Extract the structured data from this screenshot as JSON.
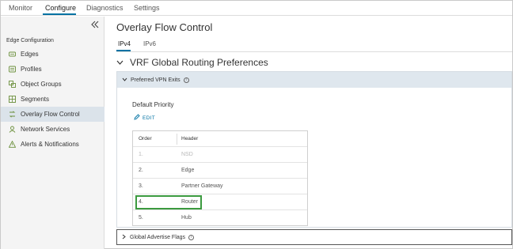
{
  "top_nav": {
    "tabs": [
      {
        "label": "Monitor",
        "active": false
      },
      {
        "label": "Configure",
        "active": true
      },
      {
        "label": "Diagnostics",
        "active": false
      },
      {
        "label": "Settings",
        "active": false
      }
    ]
  },
  "sidebar": {
    "collapse_icon": "double-chevron-left-icon",
    "section_title": "Edge Configuration",
    "items": [
      {
        "label": "Edges",
        "icon": "edge-icon",
        "active": false
      },
      {
        "label": "Profiles",
        "icon": "profile-icon",
        "active": false
      },
      {
        "label": "Object Groups",
        "icon": "object-groups-icon",
        "active": false
      },
      {
        "label": "Segments",
        "icon": "segments-icon",
        "active": false
      },
      {
        "label": "Overlay Flow Control",
        "icon": "overlay-flow-icon",
        "active": true
      },
      {
        "label": "Network Services",
        "icon": "network-services-icon",
        "active": false
      },
      {
        "label": "Alerts & Notifications",
        "icon": "alert-icon",
        "active": false
      }
    ]
  },
  "main": {
    "title": "Overlay Flow Control",
    "tabs": [
      {
        "label": "IPv4",
        "active": true
      },
      {
        "label": "IPv6",
        "active": false
      }
    ],
    "section_title": "VRF Global Routing Preferences",
    "panel": {
      "title": "Preferred VPN Exits",
      "default_priority_label": "Default Priority",
      "edit_label": "EDIT",
      "table": {
        "headers": [
          "Order",
          "Header"
        ],
        "rows": [
          {
            "order": "1.",
            "header": "NSD",
            "disabled": true
          },
          {
            "order": "2.",
            "header": "Edge",
            "disabled": false
          },
          {
            "order": "3.",
            "header": "Partner Gateway",
            "disabled": false
          },
          {
            "order": "4.",
            "header": "Router",
            "disabled": false,
            "highlighted": true
          },
          {
            "order": "5.",
            "header": "Hub",
            "disabled": false
          }
        ]
      }
    },
    "collapsed_section": {
      "title": "Global Advertise Flags"
    }
  },
  "colors": {
    "accent": "#0072a3",
    "highlight": "#3b9a3f",
    "panel_header_bg": "#dfe7ee",
    "sidebar_active_bg": "#dbe3ea"
  }
}
